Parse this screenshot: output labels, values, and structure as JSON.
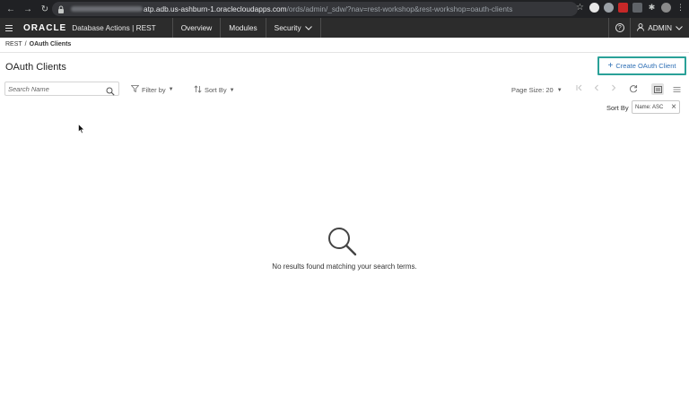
{
  "browser": {
    "url_host": "atp.adb.us-ashburn-1.oraclecloudapps.com",
    "url_path": "/ords/admin/_sdw/?nav=rest-workshop&rest-workshop=oauth-clients"
  },
  "header": {
    "brand": "ORACLE",
    "product": "Database Actions | REST",
    "tabs": [
      {
        "label": "Overview"
      },
      {
        "label": "Modules"
      },
      {
        "label": "Security"
      }
    ],
    "user": "ADMIN"
  },
  "breadcrumb": {
    "root": "REST",
    "separator": "/",
    "current": "OAuth Clients"
  },
  "page": {
    "title": "OAuth Clients",
    "create_button": "Create OAuth Client"
  },
  "toolbar": {
    "search_placeholder": "Search Name",
    "filter_label": "Filter by",
    "sort_label": "Sort By",
    "page_size_label": "Page Size: 20",
    "sort_by_label": "Sort By",
    "sort_chip": "Name: ASC"
  },
  "empty_state": {
    "message": "No results found matching your search terms."
  },
  "colors": {
    "header_bg": "#2c2c2c",
    "accent_link": "#2e6fb5",
    "highlight_border": "#2aa198"
  }
}
